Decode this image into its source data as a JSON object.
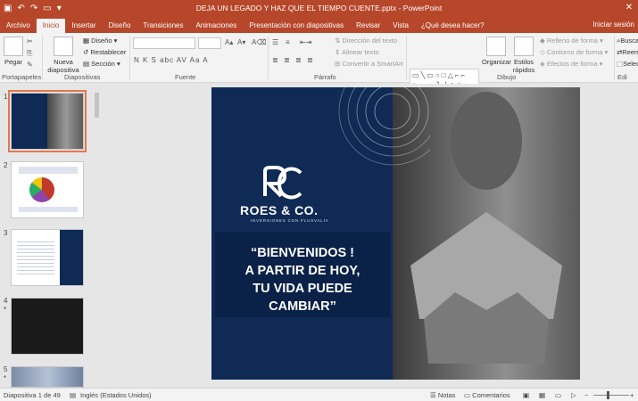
{
  "window": {
    "title": "DEJA UN LEGADO Y HAZ QUE EL TIEMPO CUENTE.pptx - PowerPoint",
    "close_glyph": "✕"
  },
  "tabs": {
    "items": [
      "Archivo",
      "Inicio",
      "Insertar",
      "Diseño",
      "Transiciones",
      "Animaciones",
      "Presentación con diapositivas",
      "Revisar",
      "Vista",
      "¿Qué desea hacer?"
    ],
    "right": "Iniciar sesión"
  },
  "ribbon": {
    "pegar": "Pegar",
    "nueva_diapositiva_line1": "Nueva",
    "nueva_diapositiva_line2": "diapositiva",
    "diseno": "Diseño",
    "restablecer": "Restablecer",
    "seccion": "Sección",
    "direccion_texto": "Dirección del texto",
    "alinear_texto": "Alinear texto",
    "convertir_smartart": "Convertir a SmartArt",
    "organizar": "Organizar",
    "estilos_rapidos_line1": "Estilos",
    "estilos_rapidos_line2": "rápidos",
    "relleno": "Relleno de forma",
    "contorno": "Contorno de forma",
    "efectos": "Efectos de forma",
    "buscar": "Buscar",
    "reemplazar": "Reem",
    "seleccionar": "Selec",
    "format_glyphs": "N K S abc AV Aa A",
    "groups": {
      "portapapeles": "Portapapeles",
      "diapositivas": "Diapositivas",
      "fuente": "Fuente",
      "parrafo": "Párrafo",
      "dibujo": "Dibujo",
      "edicion": "Edi"
    }
  },
  "thumbnails": [
    {
      "number": "1",
      "star": ""
    },
    {
      "number": "2",
      "star": ""
    },
    {
      "number": "3",
      "star": ""
    },
    {
      "number": "4",
      "star": "*"
    },
    {
      "number": "5",
      "star": "*"
    }
  ],
  "slide": {
    "logo_name": "ROES & CO.",
    "logo_tagline": "INVERSIONES CON PLUSVALÍA",
    "welcome_lines": [
      "“BIENVENIDOS !",
      "A PARTIR DE HOY,",
      "TU VIDA PUEDE",
      "CAMBIAR”"
    ]
  },
  "status": {
    "slide_info": "Diapositiva 1 de 49",
    "language": "Inglés (Estados Unidos)",
    "notas": "Notas",
    "comentarios": "Comentarios"
  },
  "colors": {
    "accent": "#b7472a",
    "slide_navy": "#0e2a55",
    "selection": "#e4764d"
  }
}
